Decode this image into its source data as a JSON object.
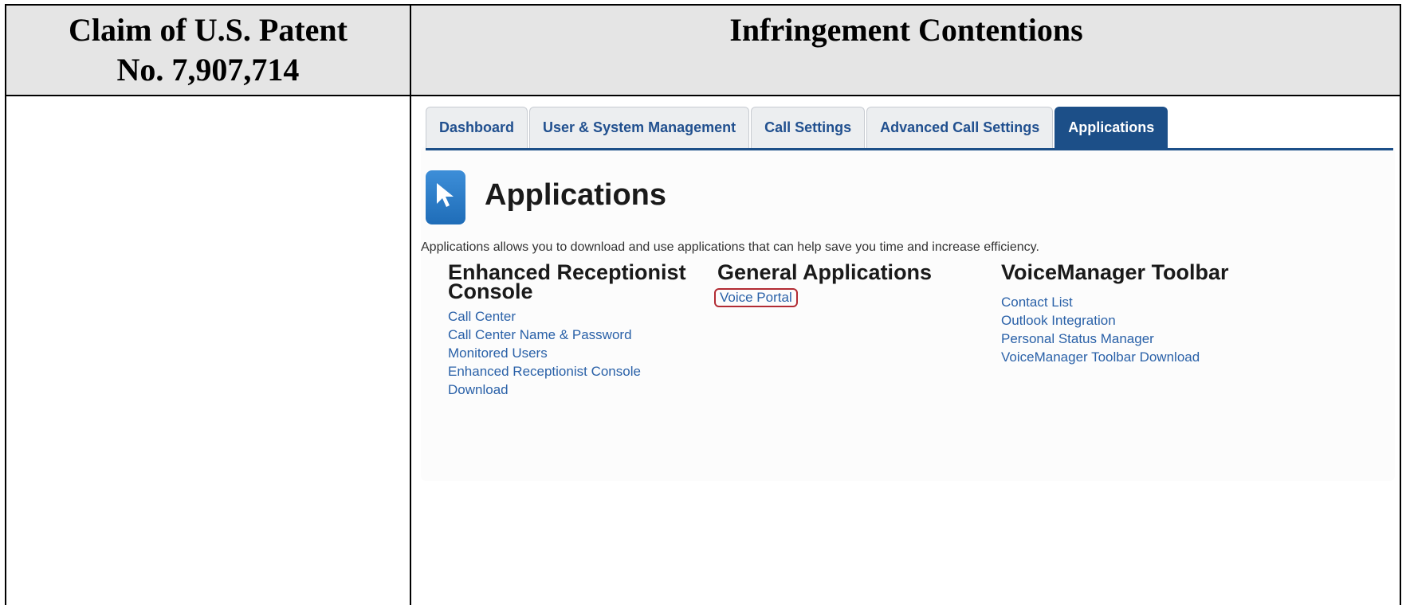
{
  "header": {
    "left_line1": "Claim of U.S. Patent",
    "left_line2": "No. 7,907,714",
    "right": "Infringement Contentions"
  },
  "screenshot": {
    "tabs": [
      {
        "label": "Dashboard"
      },
      {
        "label": "User & System Management"
      },
      {
        "label": "Call Settings"
      },
      {
        "label": "Advanced Call Settings"
      },
      {
        "label": "Applications",
        "active": true
      }
    ],
    "icon": "cursor-arrow-icon",
    "title": "Applications",
    "description": "Applications allows you to download and use applications that can help save you time and increase efficiency.",
    "sections": [
      {
        "title_line1": "Enhanced Receptionist",
        "title_line2": "Console",
        "links": [
          "Call Center",
          "Call Center Name & Password",
          "Monitored Users",
          "Enhanced Receptionist Console",
          "Download"
        ]
      },
      {
        "title": "General Applications",
        "links": [
          "Voice Portal"
        ]
      },
      {
        "title": "VoiceManager Toolbar",
        "links": [
          "Contact List",
          "Outlook Integration",
          "Personal Status Manager",
          "VoiceManager Toolbar Download"
        ]
      }
    ],
    "colors": {
      "tab_active": "#1c4f88",
      "link": "#2a61a8",
      "highlight_border": "#b22b33"
    }
  }
}
